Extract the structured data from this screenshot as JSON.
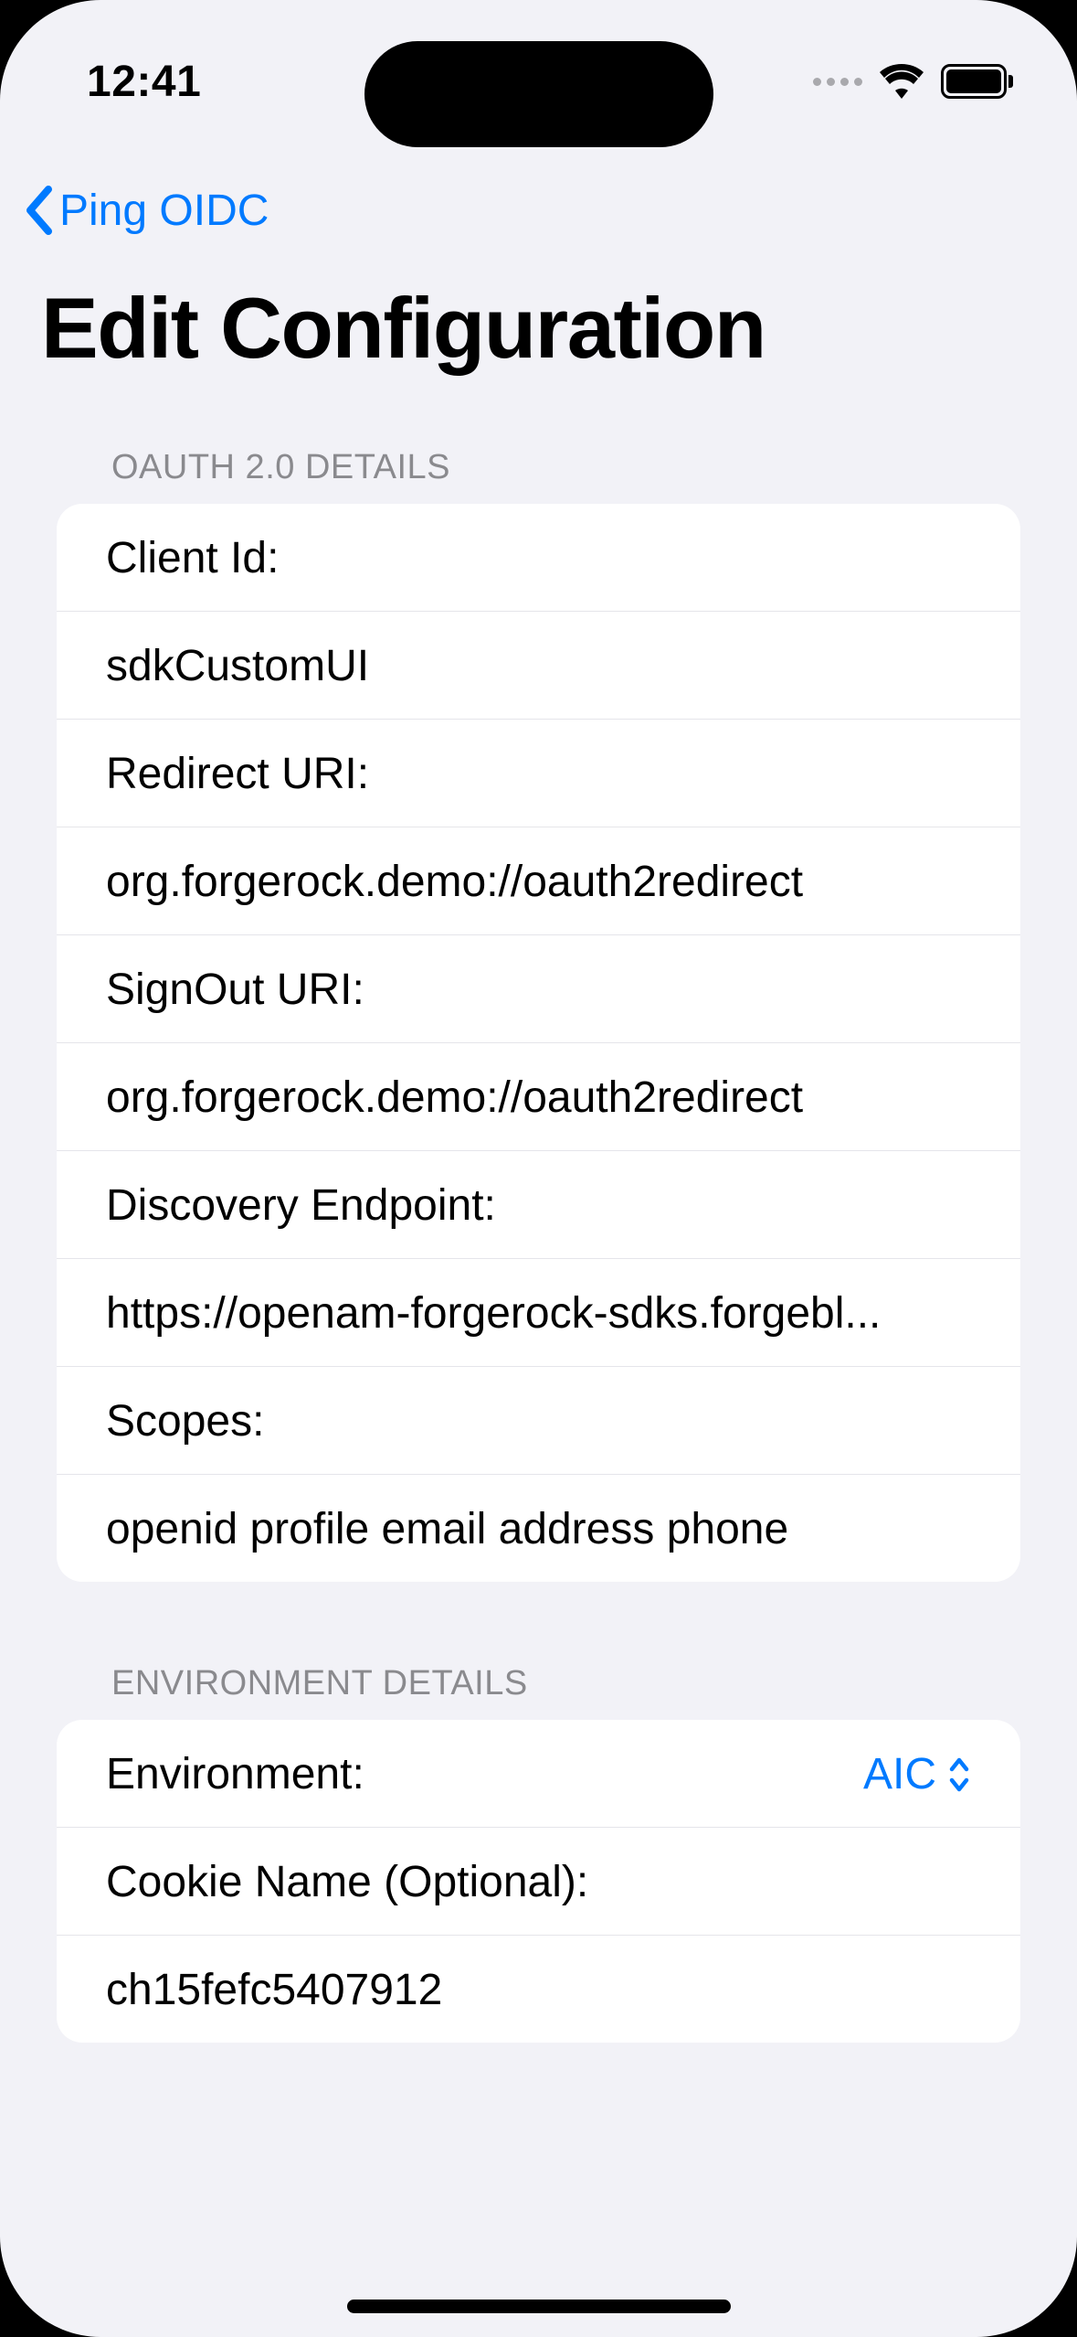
{
  "status": {
    "time": "12:41"
  },
  "nav": {
    "back_label": "Ping OIDC"
  },
  "page": {
    "title": "Edit Configuration"
  },
  "sections": {
    "oauth": {
      "header": "OAUTH 2.0 DETAILS",
      "rows": {
        "client_id_label": "Client Id:",
        "client_id_value": "sdkCustomUI",
        "redirect_uri_label": "Redirect URI:",
        "redirect_uri_value": "org.forgerock.demo://oauth2redirect",
        "signout_uri_label": "SignOut URI:",
        "signout_uri_value": "org.forgerock.demo://oauth2redirect",
        "discovery_label": "Discovery Endpoint:",
        "discovery_value": "https://openam-forgerock-sdks.forgebl...",
        "scopes_label": "Scopes:",
        "scopes_value": "openid profile email address phone"
      }
    },
    "environment": {
      "header": "ENVIRONMENT DETAILS",
      "rows": {
        "env_label": "Environment:",
        "env_value": "AIC",
        "cookie_label": "Cookie Name (Optional):",
        "cookie_value": "ch15fefc5407912"
      }
    }
  }
}
